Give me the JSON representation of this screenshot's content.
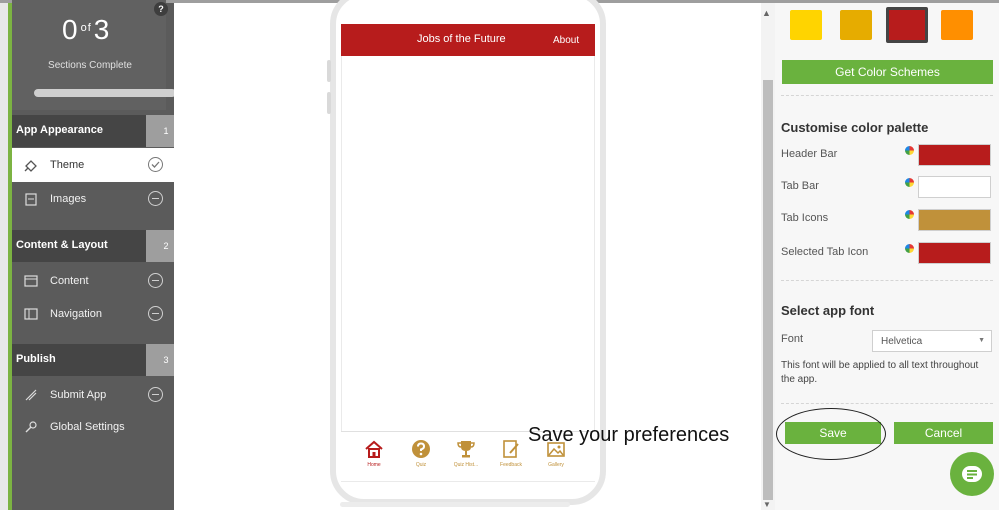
{
  "sidebar": {
    "progress": {
      "completed": "0",
      "of_label": "of",
      "total": "3",
      "label": "Sections Complete",
      "help_icon": "question-icon",
      "fraction": 0
    },
    "sections": [
      {
        "title": "App Appearance",
        "number": "1",
        "items": [
          {
            "label": "Theme",
            "icon": "paint-bucket-icon",
            "status": "complete-check-icon",
            "active": true
          },
          {
            "label": "Images",
            "icon": "image-icon",
            "status": "incomplete-dash-icon"
          }
        ]
      },
      {
        "title": "Content & Layout",
        "number": "2",
        "items": [
          {
            "label": "Content",
            "icon": "content-icon",
            "status": "incomplete-dash-icon"
          },
          {
            "label": "Navigation",
            "icon": "navigation-icon",
            "status": "incomplete-dash-icon"
          }
        ]
      },
      {
        "title": "Publish",
        "number": "3",
        "items": [
          {
            "label": "Submit App",
            "icon": "rocket-icon",
            "status": "incomplete-dash-icon"
          },
          {
            "label": "Global Settings",
            "icon": "settings-icon"
          }
        ]
      }
    ]
  },
  "phone": {
    "header_title": "Jobs of the Future",
    "header_about": "About",
    "tabs": [
      {
        "label": "Home",
        "icon": "home-icon"
      },
      {
        "label": "Quiz",
        "icon": "question-circle-icon"
      },
      {
        "label": "Quiz Hist...",
        "icon": "trophy-icon"
      },
      {
        "label": "Feedback",
        "icon": "feedback-icon"
      },
      {
        "label": "Gallery",
        "icon": "gallery-icon"
      }
    ]
  },
  "annotation": {
    "text": "Save your preferences"
  },
  "panel": {
    "swatches": [
      "#ffd400",
      "#e6ac00",
      "#b71c1c",
      "#ff8f00"
    ],
    "get_schemes_label": "Get Color Schemes",
    "palette_title": "Customise color palette",
    "palette_rows": [
      {
        "label": "Header Bar",
        "color": "#b71c1c"
      },
      {
        "label": "Tab Bar",
        "color": "#ffffff"
      },
      {
        "label": "Tab Icons",
        "color": "#c0913a"
      },
      {
        "label": "Selected Tab Icon",
        "color": "#b71c1c"
      }
    ],
    "font_title": "Select app font",
    "font_label": "Font",
    "font_value": "Helvetica",
    "font_help": "This font will be applied to all text throughout the app.",
    "save_label": "Save",
    "cancel_label": "Cancel"
  },
  "colors": {
    "accent_green": "#6ab23e",
    "brand_red": "#b71c1c",
    "sidebar_bg": "#5b5b5b"
  }
}
